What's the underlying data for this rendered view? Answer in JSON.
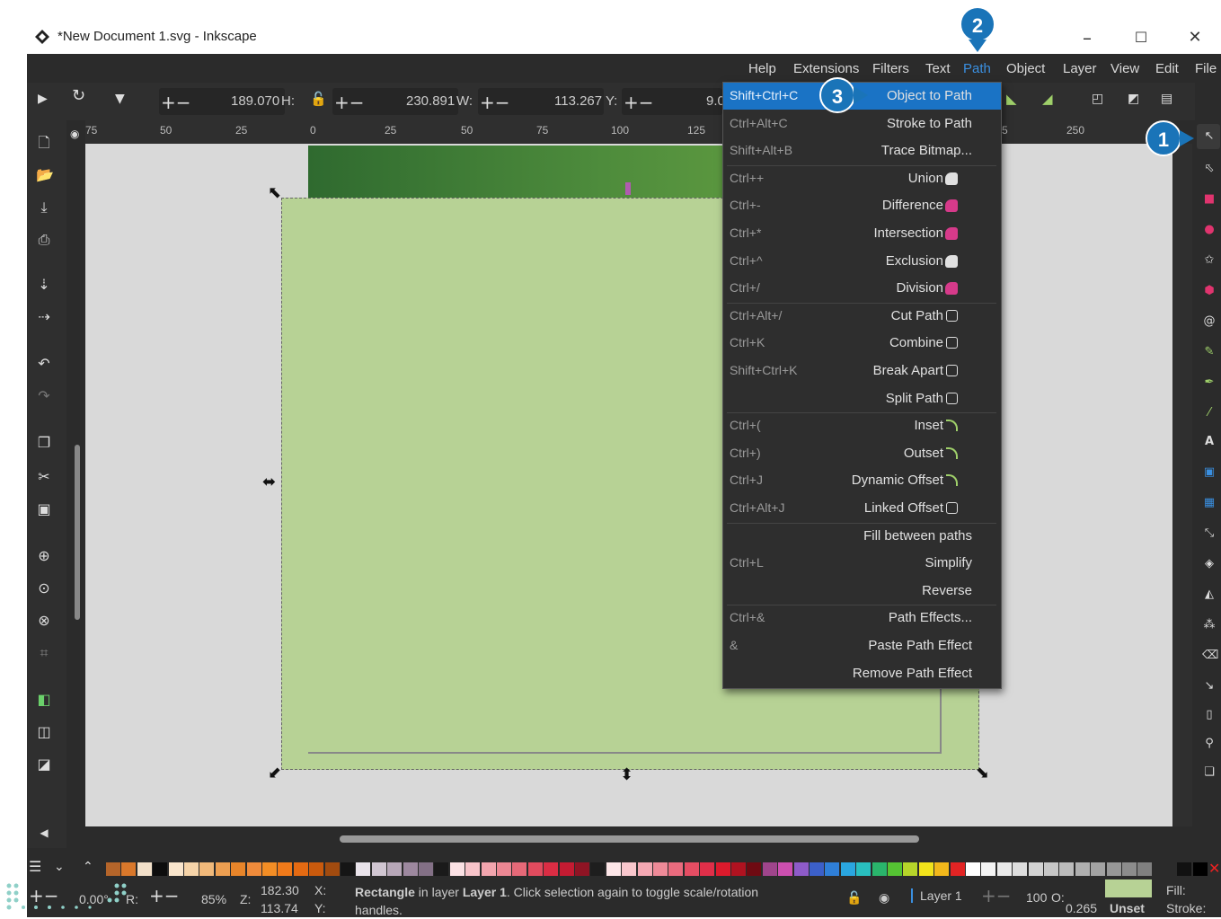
{
  "window": {
    "title": "*New Document 1.svg - Inkscape",
    "min": "–",
    "max": "☐",
    "close": "✕"
  },
  "menubar": [
    "Help",
    "Extensions",
    "Filters",
    "Text",
    "Path",
    "Object",
    "Layer",
    "View",
    "Edit",
    "File"
  ],
  "toolbar": {
    "h_label": "H:",
    "h_value": "189.070",
    "w_label": "W:",
    "w_value": "230.891",
    "y_label": "Y:",
    "y_value": "113.267",
    "x_value": "9.0"
  },
  "ruler_top": [
    "75",
    "50",
    "25",
    "0",
    "25",
    "50",
    "75",
    "100",
    "125",
    "5",
    "250"
  ],
  "path_menu": [
    {
      "shortcut": "Shift+Ctrl+C",
      "label": "Object to Path",
      "highlight": true
    },
    {
      "shortcut": "Ctrl+Alt+C",
      "label": "Stroke to Path"
    },
    {
      "shortcut": "Shift+Alt+B",
      "label": "Trace Bitmap..."
    },
    {
      "shortcut": "Ctrl++",
      "label": "Union"
    },
    {
      "shortcut": "Ctrl+-",
      "label": "Difference"
    },
    {
      "shortcut": "Ctrl+*",
      "label": "Intersection"
    },
    {
      "shortcut": "Ctrl+^",
      "label": "Exclusion"
    },
    {
      "shortcut": "Ctrl+/",
      "label": "Division"
    },
    {
      "shortcut": "Ctrl+Alt+/",
      "label": "Cut Path"
    },
    {
      "shortcut": "Ctrl+K",
      "label": "Combine"
    },
    {
      "shortcut": "Shift+Ctrl+K",
      "label": "Break Apart"
    },
    {
      "shortcut": "",
      "label": "Split Path"
    },
    {
      "shortcut": "Ctrl+(",
      "label": "Inset"
    },
    {
      "shortcut": "Ctrl+)",
      "label": "Outset"
    },
    {
      "shortcut": "Ctrl+J",
      "label": "Dynamic Offset"
    },
    {
      "shortcut": "Ctrl+Alt+J",
      "label": "Linked Offset"
    },
    {
      "shortcut": "",
      "label": "Fill between paths"
    },
    {
      "shortcut": "Ctrl+L",
      "label": "Simplify"
    },
    {
      "shortcut": "",
      "label": "Reverse"
    },
    {
      "shortcut": "Ctrl+&",
      "label": "Path Effects..."
    },
    {
      "shortcut": "&",
      "label": "Paste Path Effect"
    },
    {
      "shortcut": "",
      "label": "Remove Path Effect"
    }
  ],
  "badges": [
    "1",
    "2",
    "3"
  ],
  "status": {
    "rotation": "0.00°",
    "r_label": "R:",
    "zoom": "85%",
    "z_label": "Z:",
    "x_coord": "182.30",
    "x_label": "X:",
    "y_coord": "113.74",
    "y_label": "Y:",
    "message_bold": "Rectangle",
    "message_1": " in layer ",
    "message_layer": "Layer 1",
    "message_2": ". Click selection again to toggle scale/rotation",
    "message_3": "handles.",
    "layer": "Layer 1",
    "opacity_value": "100",
    "opacity_label": "O:",
    "stroke_width": "0.265",
    "unset": "Unset",
    "fill_label": "Fill:",
    "stroke_label": "Stroke:"
  },
  "colors": {
    "accent": "#1a74b8",
    "highlight": "#1a73c5",
    "fill_swatch": "#b7d295"
  },
  "palette": [
    "#b5652a",
    "#d9782b",
    "#f2e0c9",
    "#0d0d0d",
    "#f9e5cc",
    "#f5d3a8",
    "#f1b97a",
    "#ed9f51",
    "#e8852a",
    "#ef8b3b",
    "#f28d25",
    "#f07a1a",
    "#e46a12",
    "#c95a0d",
    "#a14b0f",
    "#151515",
    "#e9e3ea",
    "#d1c6d2",
    "#b7a7b8",
    "#9d889f",
    "#837086",
    "#1a1a1a",
    "#fbe1e4",
    "#f7c3c9",
    "#f2a5ae",
    "#ec8793",
    "#e66978",
    "#e14b5e",
    "#db2d44",
    "#c41b32",
    "#8f1424",
    "#1e1e1e",
    "#fde6e8",
    "#f9c7cd",
    "#f4a8b3",
    "#ef8a98",
    "#ea6b7e",
    "#e54d63",
    "#e02f49",
    "#dc1a2c",
    "#b01220",
    "#6e0a12",
    "#a0458c",
    "#cc4fb0",
    "#8e5bc9",
    "#3c60c9",
    "#2f7fd8",
    "#2aa6e0",
    "#29bfbf",
    "#2ab56c",
    "#55c333",
    "#b6d52a",
    "#f2e31b",
    "#f2b81b",
    "#e22424",
    "#ffffff",
    "#f4f4f4",
    "#e9e9e9",
    "#dddddd",
    "#d2d2d2",
    "#c6c6c6",
    "#bbbbbb",
    "#afafaf",
    "#a3a3a3",
    "#979797",
    "#8c8c8c",
    "#808080"
  ]
}
